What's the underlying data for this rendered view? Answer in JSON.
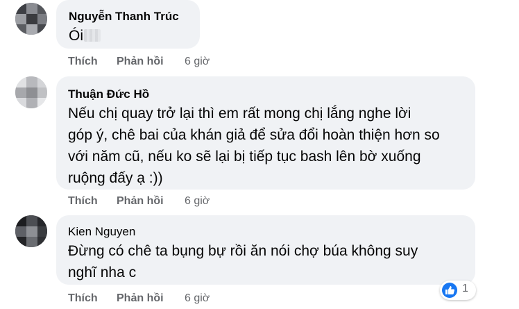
{
  "colors": {
    "bubble_bg": "#f0f2f5",
    "text": "#050505",
    "secondary_text": "#65676b",
    "like_blue": "#1877f2"
  },
  "comments": [
    {
      "author": "Nguyễn Thanh Trúc",
      "text": "Ói",
      "like_label": "Thích",
      "reply_label": "Phản hồi",
      "time": "6 giờ"
    },
    {
      "author": "Thuận Đức Hồ",
      "lines": [
        "Nếu chị quay trở lại thì em rất mong chị lắng nghe lời",
        "góp ý, chê bai của khán giả để sửa đổi hoàn thiện hơn so",
        "với năm cũ, nếu ko sẽ lại bị tiếp tục bash lên bờ xuống",
        "ruộng đấy ạ :))"
      ],
      "like_label": "Thích",
      "reply_label": "Phản hồi",
      "time": "6 giờ"
    },
    {
      "author": "Kien Nguyen",
      "lines": [
        "Đừng có chê ta bụng bự rồi ăn nói chợ búa không suy",
        "nghĩ nha c"
      ],
      "like_label": "Thích",
      "reply_label": "Phản hồi",
      "time": "6 giờ",
      "reaction": {
        "icon": "like-icon",
        "count": "1"
      }
    }
  ]
}
